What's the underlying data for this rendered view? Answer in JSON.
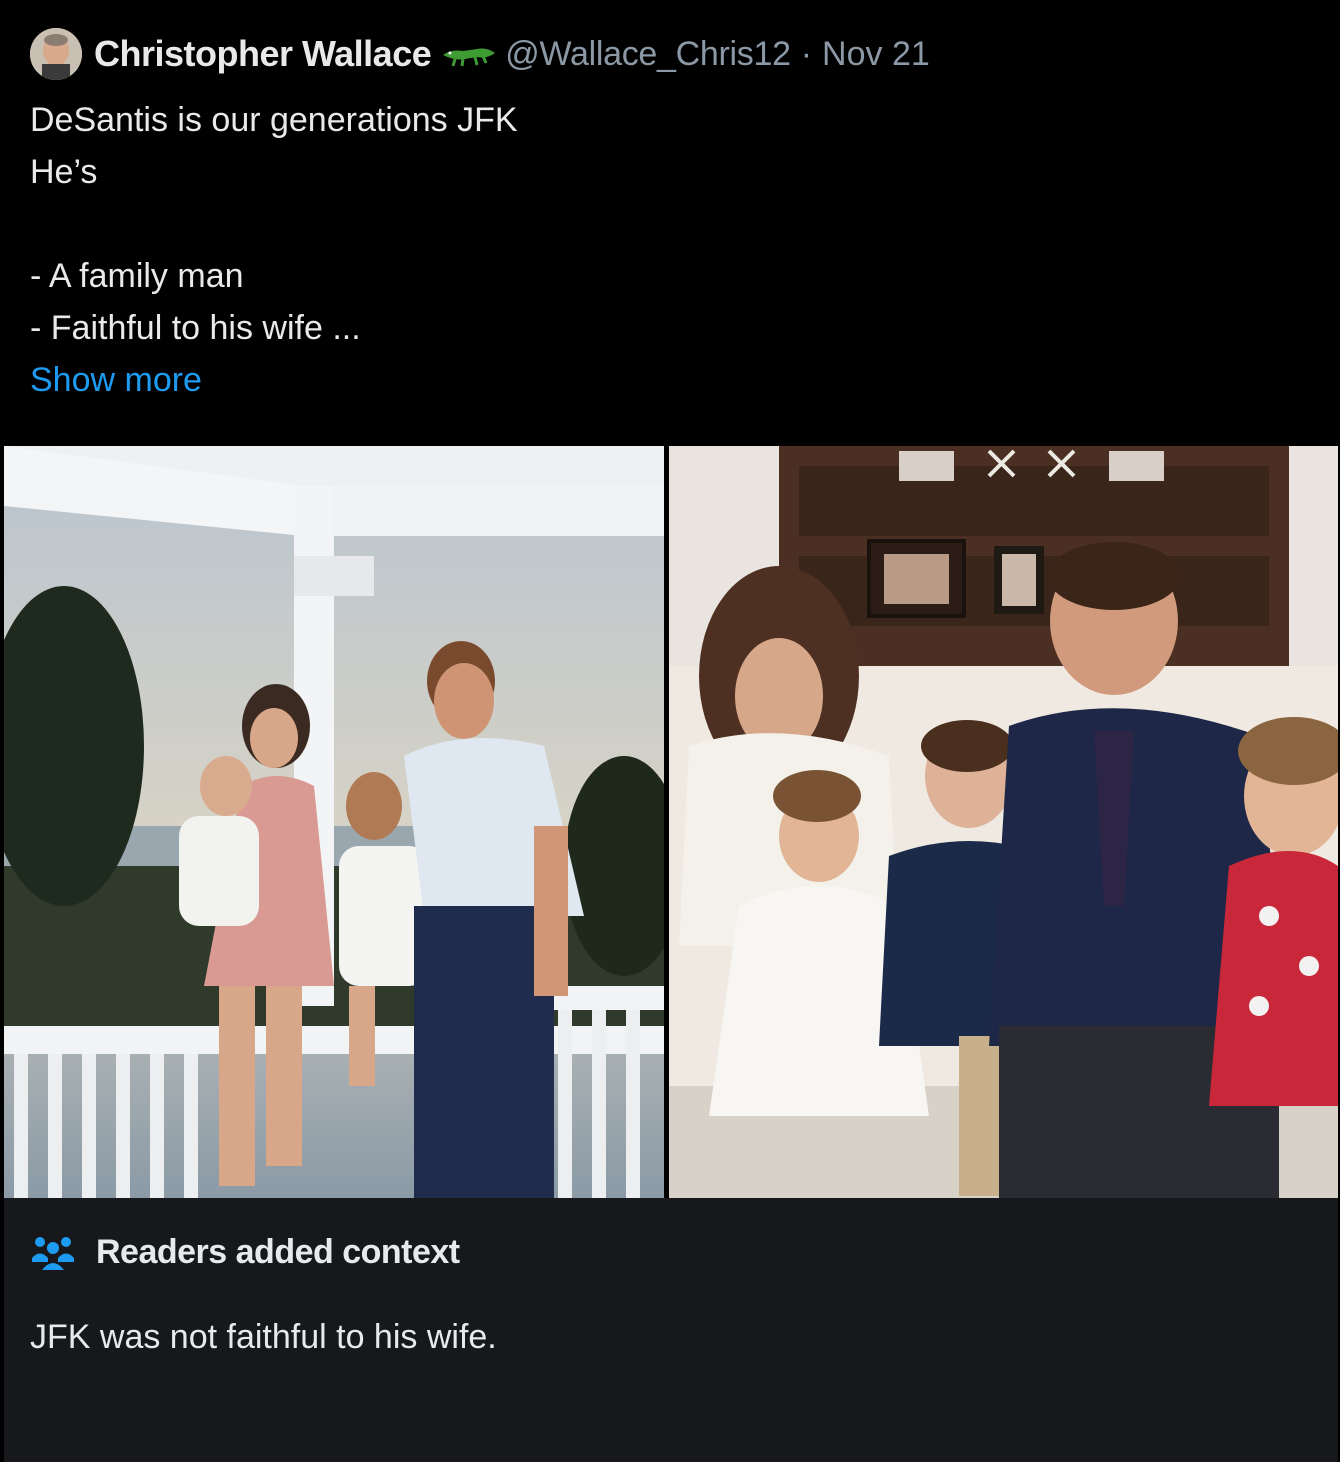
{
  "tweet": {
    "author_name": "Christopher Wallace",
    "author_handle": "@Wallace_Chris12",
    "separator": "·",
    "date": "Nov 21",
    "author_badge_icon": "alligator-emoji-icon",
    "text_lines": [
      "DeSantis is our generations JFK",
      "He’s",
      "",
      "- A family man",
      "- Faithful to his wife ..."
    ],
    "show_more_label": "Show more",
    "link_color": "#1d9bf0"
  },
  "media": {
    "images": [
      {
        "description_icon": "kennedy-family-porch-photo"
      },
      {
        "description_icon": "desantis-family-photo"
      }
    ]
  },
  "community_note": {
    "icon": "people-icon",
    "title": "Readers added context",
    "body": "JFK was not faithful to his wife.",
    "accent_color": "#1d9bf0"
  }
}
